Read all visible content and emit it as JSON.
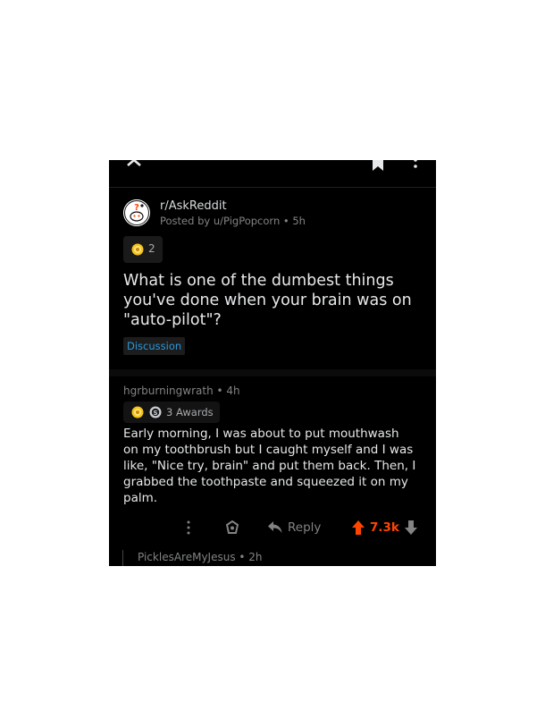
{
  "post": {
    "subreddit": "r/AskReddit",
    "meta": "Posted by u/PigPopcorn • 5h",
    "award_count": "2",
    "title_lines": [
      "What is one of the dumbest things",
      "you've done when your brain was on",
      "\"auto-pilot\"?"
    ],
    "flair": "Discussion"
  },
  "comment": {
    "author_line": "hgrburningwrath • 4h",
    "awards_label": "3 Awards",
    "body_lines": [
      "Early morning, I was about to put mouthwash",
      "on my toothbrush but I caught myself and I was",
      "like, \"Nice try, brain\" and put them back. Then, I",
      "grabbed the toothpaste and squeezed it on my",
      "palm."
    ],
    "reply_label": "Reply",
    "score": "7.3k"
  },
  "next_comment": {
    "author_line": "PicklesAreMyJesus • 2h"
  },
  "icons": {
    "close": "close-icon",
    "bookmark": "bookmark-icon",
    "more": "more-vertical-icon",
    "award": "award-icon",
    "reply": "reply-arrow-icon",
    "upvote": "upvote-arrow-icon",
    "downvote": "downvote-arrow-icon"
  },
  "colors": {
    "background": "#000000",
    "upvote": "#ff4500",
    "flair": "#2c99d9",
    "muted": "#818384"
  }
}
